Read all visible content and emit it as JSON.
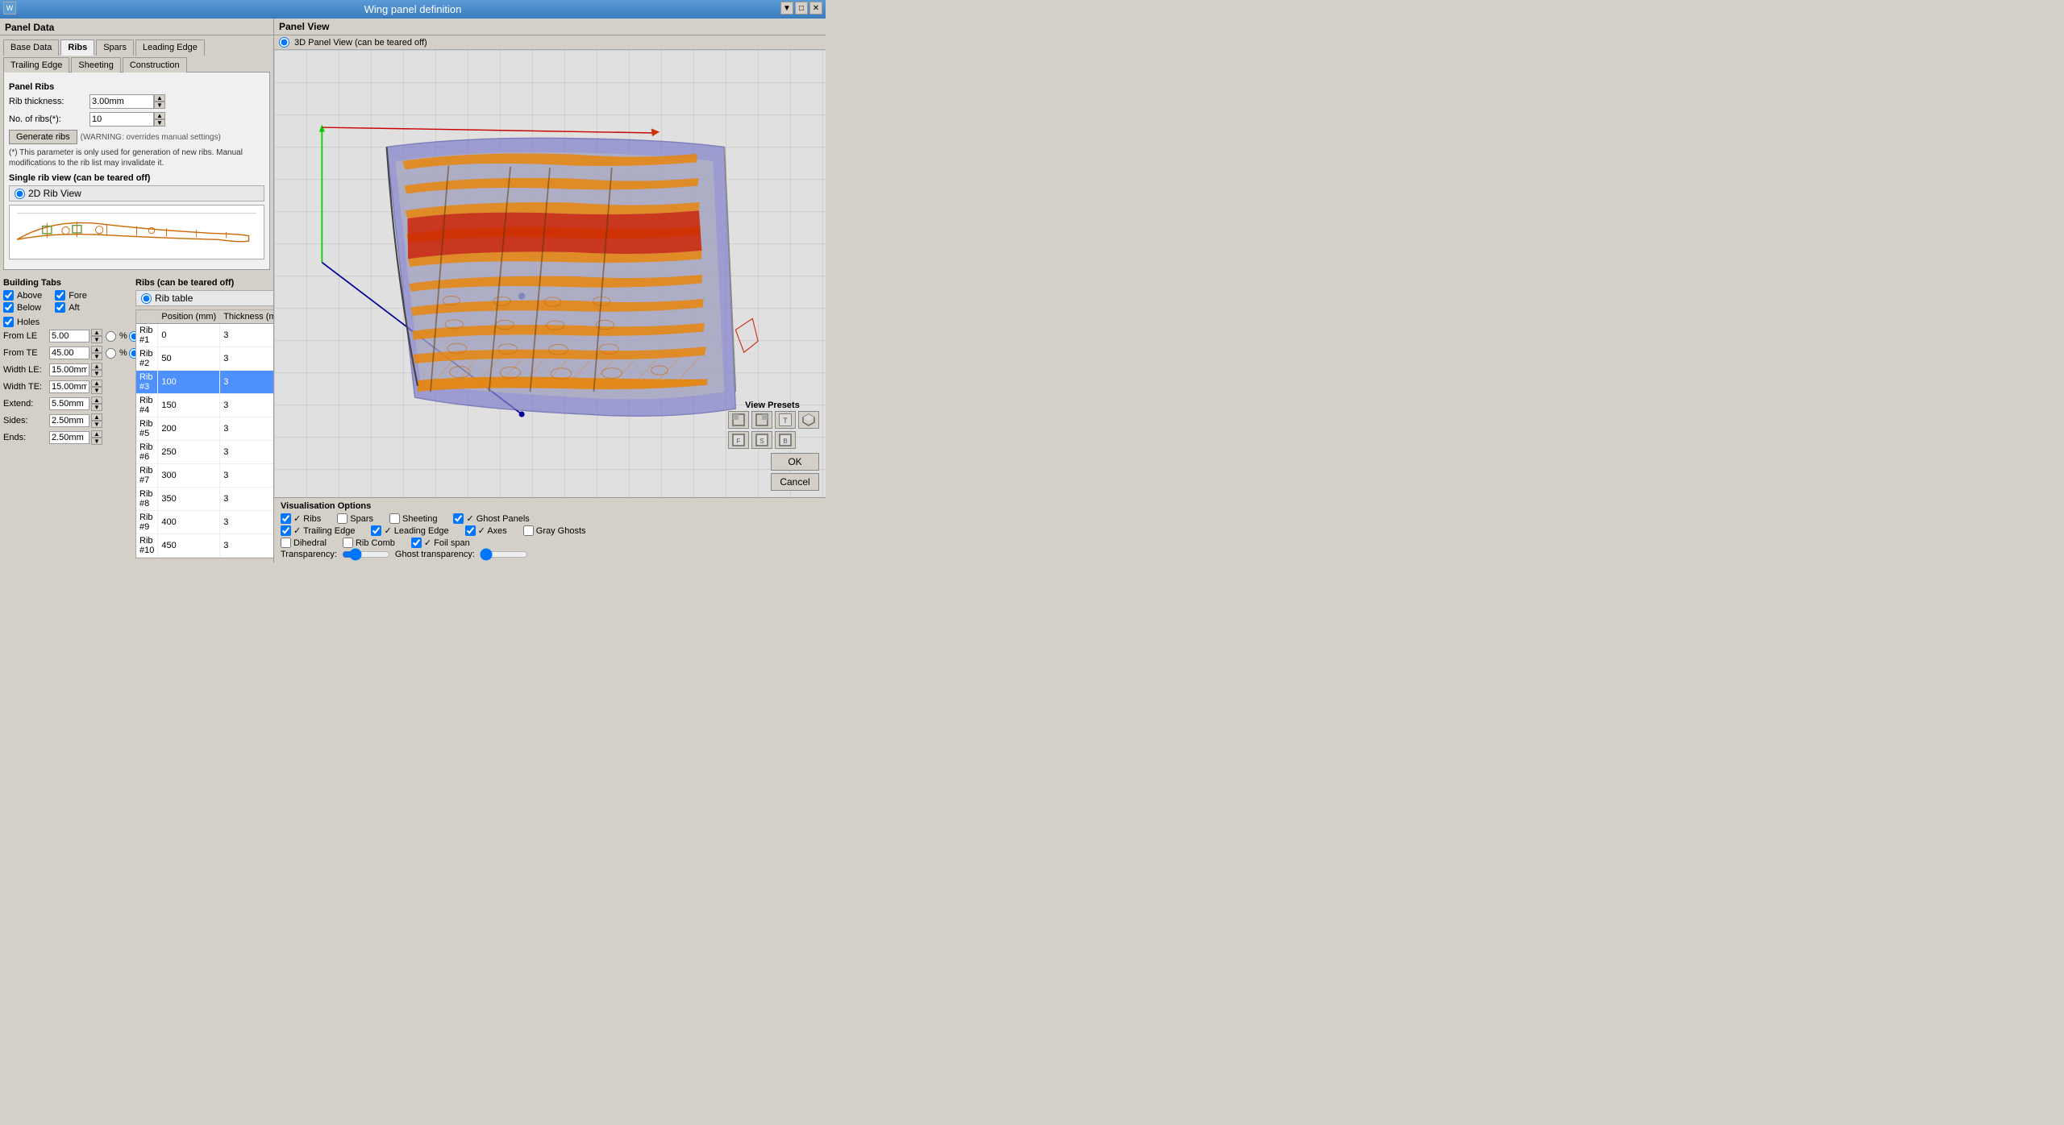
{
  "window": {
    "title": "Wing panel definition",
    "icon": "W"
  },
  "titlebar_buttons": [
    "▼",
    "□",
    "✕"
  ],
  "left_panel": {
    "section_title": "Panel Data",
    "tabs": [
      {
        "label": "Base Data",
        "active": false
      },
      {
        "label": "Ribs",
        "active": true
      },
      {
        "label": "Spars",
        "active": false
      },
      {
        "label": "Leading Edge",
        "active": false
      },
      {
        "label": "Trailing Edge",
        "active": false
      },
      {
        "label": "Sheeting",
        "active": false
      },
      {
        "label": "Construction",
        "active": false
      }
    ],
    "panel_ribs": {
      "title": "Panel Ribs",
      "rib_thickness_label": "Rib thickness:",
      "rib_thickness_value": "3.00mm",
      "no_of_ribs_label": "No. of ribs(*):",
      "no_of_ribs_value": "10",
      "generate_ribs_btn": "Generate ribs",
      "warning_text": "(WARNING: overrides manual settings)",
      "note": "(*) This parameter is only used for generation of new ribs. Manual modifications to the rib list may invalidate it."
    },
    "single_rib_view": {
      "title": "Single rib view (can be teared off)",
      "radio_label": "2D Rib View"
    },
    "building_tabs": {
      "title": "Building Tabs",
      "above": {
        "checked": true,
        "label": "Above"
      },
      "fore": {
        "checked": true,
        "label": "Fore"
      },
      "below": {
        "checked": true,
        "label": "Below"
      },
      "aft": {
        "checked": true,
        "label": "Aft"
      },
      "holes": {
        "checked": true,
        "label": "Holes"
      },
      "from_le_label": "From LE",
      "from_le_value": "5.00",
      "from_te_label": "From TE",
      "from_te_value": "45.00",
      "width_le_label": "Width LE:",
      "width_le_value": "15.00mm",
      "width_te_label": "Width TE:",
      "width_te_value": "15.00mm",
      "extend_label": "Extend:",
      "extend_value": "5.50mm",
      "sides_label": "Sides:",
      "sides_value": "2.50mm",
      "ends_label": "Ends:",
      "ends_value": "2.50mm"
    },
    "ribs_table": {
      "title": "Ribs (can be teared off)",
      "radio_label": "Rib table",
      "columns": [
        "",
        "Position (mm)",
        "Thickness (mm)"
      ],
      "rows": [
        {
          "name": "Rib #1",
          "position": "0",
          "thickness": "3",
          "selected": false
        },
        {
          "name": "Rib #2",
          "position": "50",
          "thickness": "3",
          "selected": false
        },
        {
          "name": "Rib #3",
          "position": "100",
          "thickness": "3",
          "selected": true
        },
        {
          "name": "Rib #4",
          "position": "150",
          "thickness": "3",
          "selected": false
        },
        {
          "name": "Rib #5",
          "position": "200",
          "thickness": "3",
          "selected": false
        },
        {
          "name": "Rib #6",
          "position": "250",
          "thickness": "3",
          "selected": false
        },
        {
          "name": "Rib #7",
          "position": "300",
          "thickness": "3",
          "selected": false
        },
        {
          "name": "Rib #8",
          "position": "350",
          "thickness": "3",
          "selected": false
        },
        {
          "name": "Rib #9",
          "position": "400",
          "thickness": "3",
          "selected": false
        },
        {
          "name": "Rib #10",
          "position": "450",
          "thickness": "3",
          "selected": false
        }
      ]
    }
  },
  "right_panel": {
    "section_title": "Panel View",
    "panel_3d_label": "3D Panel View (can be teared off)"
  },
  "viz_options": {
    "title": "Visualisation Options",
    "checkboxes": [
      {
        "label": "Ribs",
        "checked": true
      },
      {
        "label": "Spars",
        "checked": false
      },
      {
        "label": "Sheeting",
        "checked": false
      },
      {
        "label": "Ghost Panels",
        "checked": true
      },
      {
        "label": "Trailing Edge",
        "checked": true
      },
      {
        "label": "Leading Edge",
        "checked": true
      },
      {
        "label": "Axes",
        "checked": true
      },
      {
        "label": "Gray Ghosts",
        "checked": false
      },
      {
        "label": "Dihedral",
        "checked": false
      },
      {
        "label": "Rib Comb",
        "checked": false
      },
      {
        "label": "Foil span",
        "checked": true
      }
    ],
    "transparency_label": "Transparency:",
    "ghost_transparency_label": "Ghost transparency:"
  },
  "view_presets": {
    "title": "View Presets",
    "buttons": [
      "◤",
      "◥",
      "▣",
      "◳",
      "◱",
      "◲"
    ]
  },
  "dialog_buttons": {
    "ok": "OK",
    "cancel": "Cancel"
  }
}
